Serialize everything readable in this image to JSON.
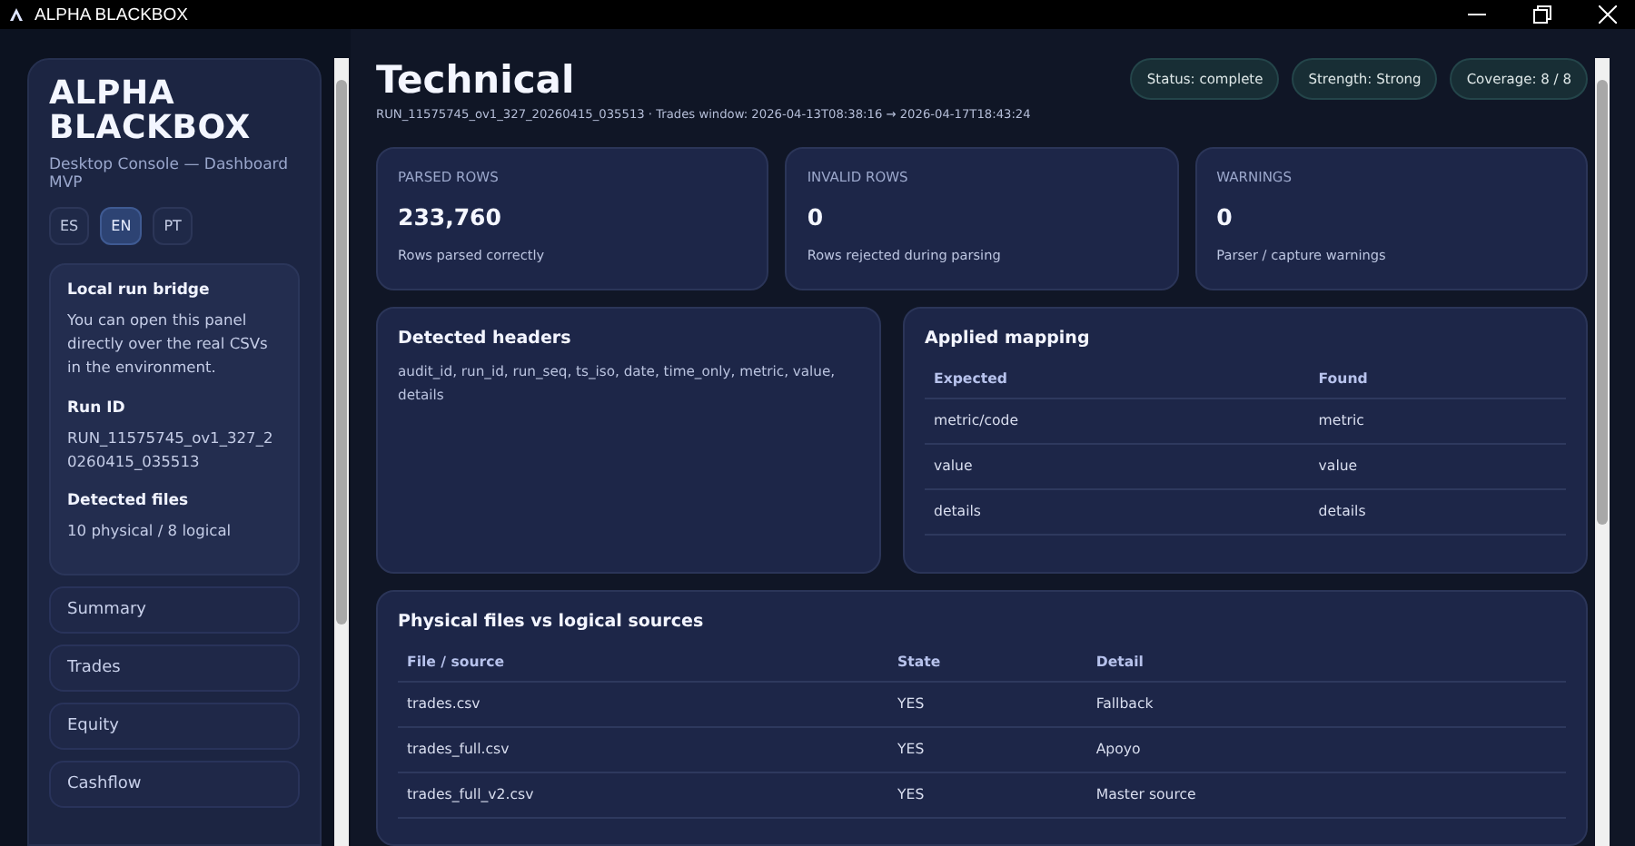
{
  "window": {
    "title": "ALPHA BLACKBOX"
  },
  "sidebar": {
    "brand": "ALPHA BLACKBOX",
    "subtitle": "Desktop Console — Dashboard MVP",
    "languages": [
      {
        "label": "ES",
        "selected": false
      },
      {
        "label": "EN",
        "selected": true
      },
      {
        "label": "PT",
        "selected": false
      }
    ],
    "bridge": {
      "title": "Local run bridge",
      "text": "You can open this panel directly over the real CSVs in the environment.",
      "run_id_label": "Run ID",
      "run_id": "RUN_11575745_ov1_327_20260415_035513",
      "files_label": "Detected files",
      "files": "10 physical / 8 logical"
    },
    "nav": [
      {
        "label": "Summary",
        "selected": false
      },
      {
        "label": "Trades",
        "selected": false
      },
      {
        "label": "Equity",
        "selected": false
      },
      {
        "label": "Cashflow",
        "selected": false
      }
    ]
  },
  "header": {
    "title": "Technical",
    "subtitle": "RUN_11575745_ov1_327_20260415_035513 · Trades window: 2026-04-13T08:38:16 → 2026-04-17T18:43:24",
    "badges": [
      "Status: complete",
      "Strength: Strong",
      "Coverage: 8 / 8"
    ]
  },
  "stats": [
    {
      "label": "PARSED ROWS",
      "value": "233,760",
      "note": "Rows parsed correctly"
    },
    {
      "label": "INVALID ROWS",
      "value": "0",
      "note": "Rows rejected during parsing"
    },
    {
      "label": "WARNINGS",
      "value": "0",
      "note": "Parser / capture warnings"
    }
  ],
  "detected_headers": {
    "title": "Detected headers",
    "text": "audit_id, run_id, run_seq, ts_iso, date, time_only, metric, value, details"
  },
  "mapping": {
    "title": "Applied mapping",
    "columns": [
      "Expected",
      "Found"
    ],
    "rows": [
      [
        "metric/code",
        "metric"
      ],
      [
        "value",
        "value"
      ],
      [
        "details",
        "details"
      ]
    ]
  },
  "files": {
    "title": "Physical files vs logical sources",
    "columns": [
      "File / source",
      "State",
      "Detail"
    ],
    "rows": [
      [
        "trades.csv",
        "YES",
        "Fallback"
      ],
      [
        "trades_full.csv",
        "YES",
        "Apoyo"
      ],
      [
        "trades_full_v2.csv",
        "YES",
        "Master source"
      ]
    ]
  }
}
